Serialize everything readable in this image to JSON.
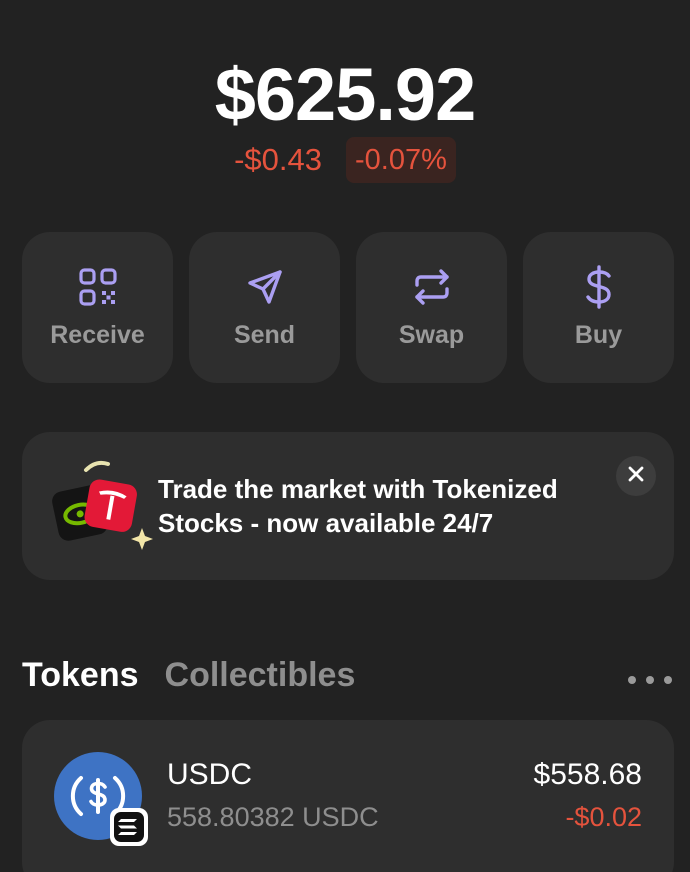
{
  "portfolio": {
    "balance": "$625.92",
    "change_amount": "-$0.43",
    "change_percent": "-0.07%"
  },
  "actions": [
    {
      "label": "Receive",
      "icon": "qr-code-icon"
    },
    {
      "label": "Send",
      "icon": "send-icon"
    },
    {
      "label": "Swap",
      "icon": "swap-icon"
    },
    {
      "label": "Buy",
      "icon": "dollar-icon"
    }
  ],
  "promo": {
    "text": "Trade the market with Tokenized Stocks - now available 24/7",
    "icon": "tokenized-stocks-icon",
    "close_icon": "close-icon"
  },
  "tabs": [
    {
      "label": "Tokens",
      "active": true
    },
    {
      "label": "Collectibles",
      "active": false
    }
  ],
  "more_icon": "more-horizontal-icon",
  "tokens": [
    {
      "name": "USDC",
      "amount": "558.80382 USDC",
      "value": "$558.68",
      "change": "-$0.02",
      "icon": "usdc-icon",
      "chain_icon": "solana-icon"
    }
  ],
  "colors": {
    "background": "#222222",
    "card": "#2e2e2e",
    "accent": "#ab9ff2",
    "negative": "#e5533d",
    "muted": "#8e8e8e"
  }
}
